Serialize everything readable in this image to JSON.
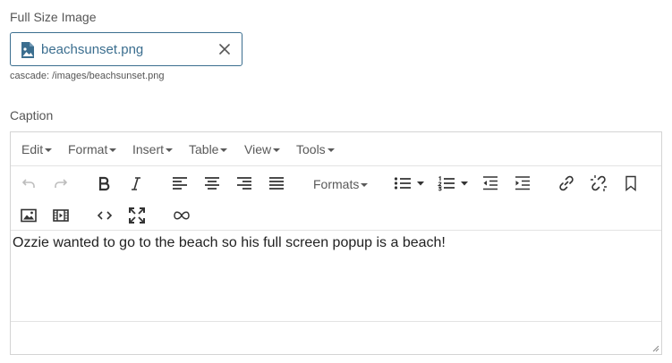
{
  "field_image": {
    "label": "Full Size Image",
    "file_name": "beachsunset.png",
    "cascade_path": "cascade: /images/beachsunset.png"
  },
  "field_caption": {
    "label": "Caption"
  },
  "editor": {
    "menu": [
      "Edit",
      "Format",
      "Insert",
      "Table",
      "View",
      "Tools"
    ],
    "formats_label": "Formats",
    "content": "Ozzie wanted to go to the beach so his full screen popup is a beach!"
  },
  "colors": {
    "accent": "#3b6e8f",
    "border": "#d4d4d4",
    "icon": "#333333",
    "icon_disabled": "#bdbdbd"
  }
}
